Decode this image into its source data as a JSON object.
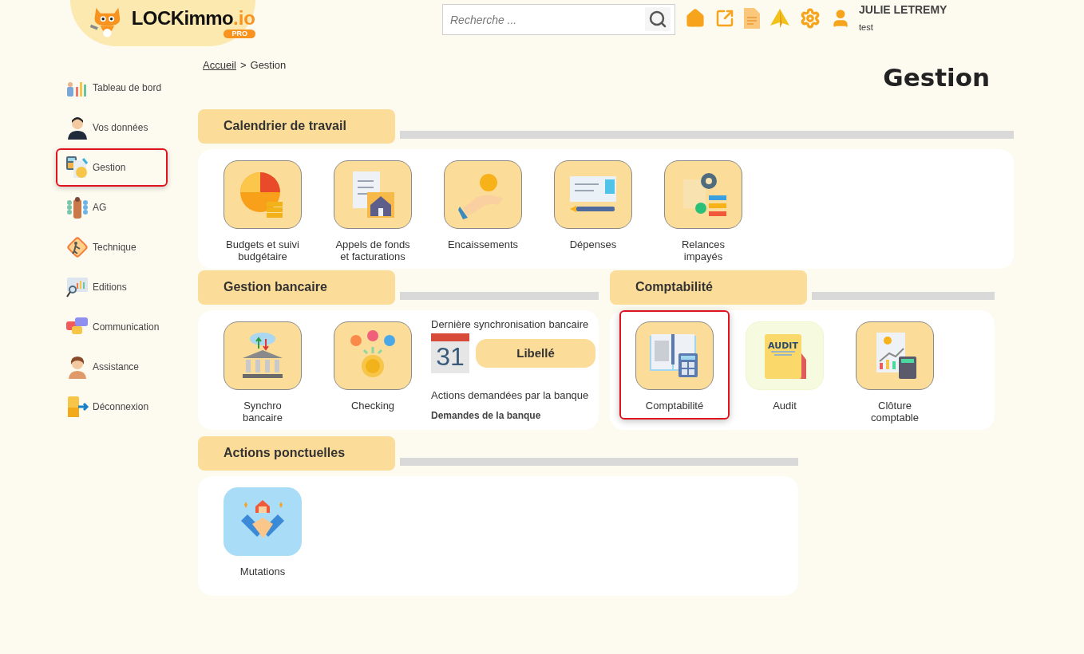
{
  "header": {
    "logo": {
      "name": "LOCKimmo",
      "suffix": ".io",
      "badge": "PRO"
    },
    "search": {
      "placeholder": "Recherche ..."
    },
    "user": {
      "name": "JULIE LETREMY",
      "subtitle": "test"
    }
  },
  "sidebar": {
    "items": [
      {
        "label": "Tableau de bord",
        "selected": false
      },
      {
        "label": "Vos données",
        "selected": false
      },
      {
        "label": "Gestion",
        "selected": true
      },
      {
        "label": "AG",
        "selected": false
      },
      {
        "label": "Technique",
        "selected": false
      },
      {
        "label": "Editions",
        "selected": false
      },
      {
        "label": "Communication",
        "selected": false
      },
      {
        "label": "Assistance",
        "selected": false
      },
      {
        "label": "Déconnexion",
        "selected": false
      }
    ]
  },
  "breadcrumb": {
    "link": "Accueil",
    "separator": ">",
    "current": "Gestion"
  },
  "page_title": "Gestion",
  "sections": [
    {
      "title": "Calendrier de travail",
      "tiles": [
        {
          "label": "Budgets et suivi budgétaire",
          "kind": "standard",
          "selected": false
        },
        {
          "label": "Appels de fonds et facturations",
          "kind": "standard",
          "selected": false
        },
        {
          "label": "Encaissements",
          "kind": "standard",
          "selected": false
        },
        {
          "label": "Dépenses",
          "kind": "standard",
          "selected": false
        },
        {
          "label": "Relances impayés",
          "kind": "standard",
          "selected": false
        }
      ]
    },
    {
      "title": "Gestion bancaire",
      "tiles": [
        {
          "label": "Synchro bancaire",
          "kind": "standard",
          "selected": false
        },
        {
          "label": "Checking",
          "kind": "standard",
          "selected": false
        }
      ],
      "sync": {
        "heading": "Dernière synchronisation bancaire",
        "calendar_day": "31",
        "button": "Libellé",
        "actions_heading": "Actions demandées par la banque",
        "actions_link": "Demandes de la banque"
      }
    },
    {
      "title": "Comptabilité",
      "tiles": [
        {
          "label": "Comptabilité",
          "kind": "standard",
          "selected": true
        },
        {
          "label": "Audit",
          "kind": "light",
          "selected": false,
          "icon_text": "AUDIT"
        },
        {
          "label": "Clôture comptable",
          "kind": "standard",
          "selected": false
        }
      ]
    },
    {
      "title": "Actions ponctuelles",
      "tiles": [
        {
          "label": "Mutations",
          "kind": "blue",
          "selected": false
        }
      ]
    }
  ]
}
